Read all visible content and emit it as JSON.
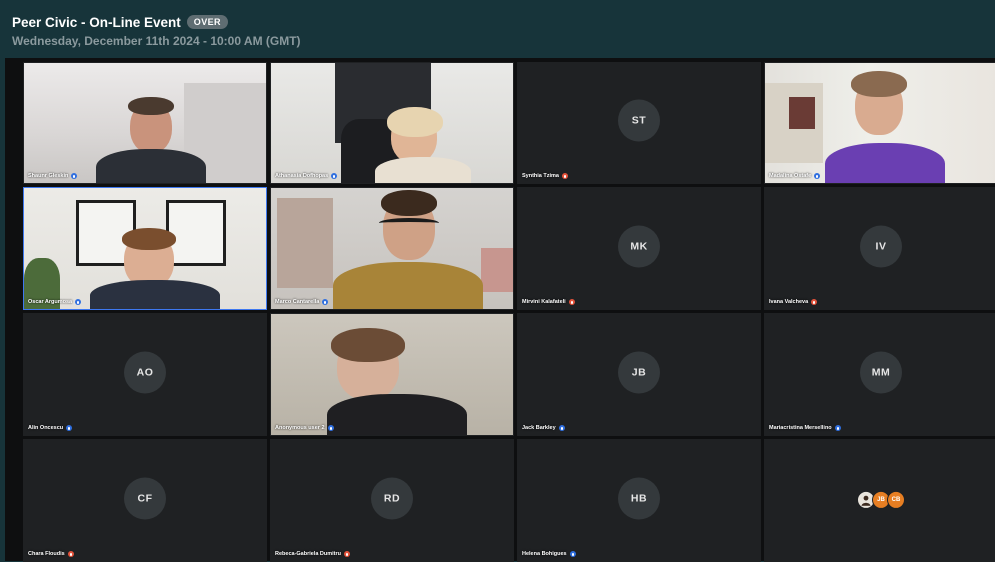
{
  "header": {
    "title": "Peer Civic - On-Line Event",
    "status": "OVER",
    "date": "Wednesday, December 11th 2024 - 10:00 AM (GMT)"
  },
  "colors": {
    "mic_off": "#e5533b",
    "mic_on": "#2f6fe0",
    "active_speaker": "#3e78f0"
  },
  "participants": [
    {
      "name": "Shaunr Gleskin",
      "video": true,
      "mic": "on",
      "icon": "microphone-icon"
    },
    {
      "name": "Athanasia Dofhopas",
      "video": true,
      "mic": "on",
      "icon": "microphone-icon"
    },
    {
      "name": "Synthia Tzima",
      "initials": "ST",
      "video": false,
      "mic": "off",
      "icon": "microphone-muted-icon"
    },
    {
      "name": "Madalina Ostafe",
      "video": true,
      "mic": "on",
      "icon": "microphone-icon"
    },
    {
      "name": "Oscar Argumosa",
      "video": true,
      "mic": "on",
      "active": true,
      "icon": "microphone-icon"
    },
    {
      "name": "Marco Cantarella",
      "video": true,
      "mic": "on",
      "icon": "microphone-icon"
    },
    {
      "name": "Mirvini Kalafateli",
      "initials": "MK",
      "video": false,
      "mic": "off",
      "icon": "microphone-muted-icon"
    },
    {
      "name": "Ivana Valcheva",
      "initials": "IV",
      "video": false,
      "mic": "off",
      "icon": "microphone-muted-icon"
    },
    {
      "name": "Alin Oncescu",
      "initials": "AO",
      "video": false,
      "mic": "on",
      "icon": "microphone-icon"
    },
    {
      "name": "Anonymous user 2",
      "video": true,
      "mic": "on",
      "icon": "microphone-icon"
    },
    {
      "name": "Jack Barkley",
      "initials": "JB",
      "video": false,
      "mic": "on",
      "icon": "microphone-icon"
    },
    {
      "name": "Mariacristina Mersellino",
      "initials": "MM",
      "video": false,
      "mic": "on",
      "icon": "microphone-icon"
    },
    {
      "name": "Chara Floudis",
      "initials": "CF",
      "video": false,
      "mic": "off",
      "icon": "microphone-muted-icon"
    },
    {
      "name": "Rebeca-Gabriela Dumitru",
      "initials": "RD",
      "video": false,
      "mic": "off",
      "icon": "microphone-muted-icon"
    },
    {
      "name": "Helena Bohigues",
      "initials": "HB",
      "video": false,
      "mic": "on",
      "icon": "microphone-icon"
    }
  ],
  "overflow": {
    "avatars": [
      "JB",
      "CB"
    ]
  }
}
